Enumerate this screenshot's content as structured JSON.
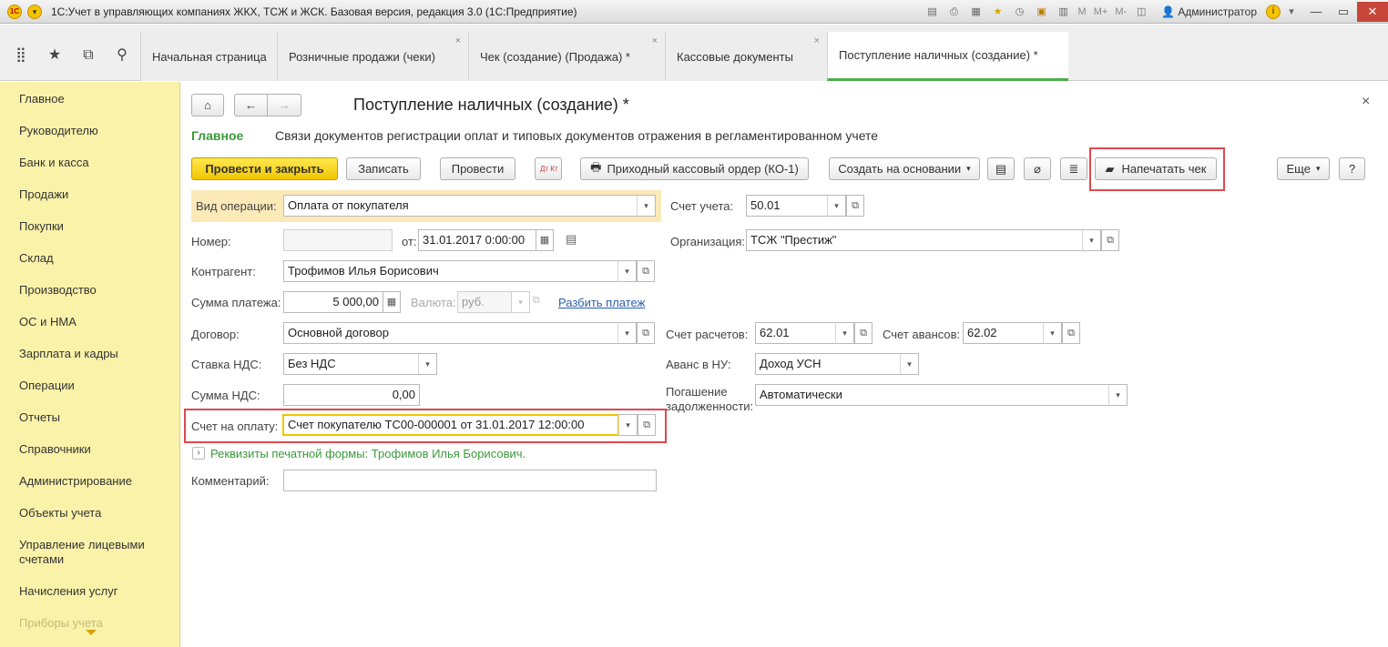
{
  "window": {
    "title": "1С:Учет в управляющих компаниях ЖКХ, ТСЖ и ЖСК. Базовая версия, редакция 3.0  (1С:Предприятие)",
    "user": "Администратор",
    "m_buttons": [
      "M",
      "M+",
      "M-"
    ]
  },
  "tabs": [
    {
      "label": "Начальная страница",
      "closable": false
    },
    {
      "label": "Розничные продажи (чеки)",
      "closable": true
    },
    {
      "label": "Чек (создание) (Продажа) *",
      "closable": true
    },
    {
      "label": "Кассовые документы",
      "closable": true
    },
    {
      "label": "Поступление наличных (создание) *",
      "closable": false,
      "active": true
    }
  ],
  "sidebar": {
    "items": [
      "Главное",
      "Руководителю",
      "Банк и касса",
      "Продажи",
      "Покупки",
      "Склад",
      "Производство",
      "ОС и НМА",
      "Зарплата и кадры",
      "Операции",
      "Отчеты",
      "Справочники",
      "Администрирование",
      "Объекты учета",
      "Управление лицевыми",
      "счетами",
      "Начисления услуг",
      "Приборы учета"
    ]
  },
  "doc": {
    "title": "Поступление наличных (создание) *",
    "nav_main": "Главное",
    "nav_links": "Связи документов регистрации оплат и типовых документов отражения в регламентированном учете",
    "close": "×"
  },
  "toolbar": {
    "post_close": "Провести и закрыть",
    "save": "Записать",
    "post": "Провести",
    "dt_kt": "Дт Кт",
    "pko": "Приходный кассовый ордер (КО-1)",
    "create_based": "Создать на основании",
    "print_check": "Напечатать чек",
    "more": "Еще",
    "help": "?"
  },
  "form": {
    "op_type_label": "Вид операции:",
    "op_type_value": "Оплата от покупателя",
    "number_label": "Номер:",
    "number_value": "",
    "from_label": "от:",
    "date_value": "31.01.2017  0:00:00",
    "counterparty_label": "Контрагент:",
    "counterparty_value": "Трофимов Илья Борисович",
    "amount_label": "Сумма платежа:",
    "amount_value": "5 000,00",
    "currency_label": "Валюта:",
    "currency_value": "руб.",
    "split_payment": "Разбить платеж",
    "contract_label": "Договор:",
    "contract_value": "Основной договор",
    "vat_rate_label": "Ставка НДС:",
    "vat_rate_value": "Без НДС",
    "vat_sum_label": "Сумма НДС:",
    "vat_sum_value": "0,00",
    "invoice_label": "Счет на оплату:",
    "invoice_value": "Счет покупателю ТС00-000001 от 31.01.2017 12:00:00",
    "print_requisites": "Реквизиты печатной формы: Трофимов Илья Борисович.",
    "comment_label": "Комментарий:",
    "comment_value": "",
    "account_label": "Счет учета:",
    "account_value": "50.01",
    "org_label": "Организация:",
    "org_value": "ТСЖ \"Престиж\"",
    "settle_label": "Счет расчетов:",
    "settle_value": "62.01",
    "advance_acc_label": "Счет авансов:",
    "advance_acc_value": "62.02",
    "advance_nu_label": "Аванс в НУ:",
    "advance_nu_value": "Доход УСН",
    "repay_label_1": "Погашение",
    "repay_label_2": "задолженности:",
    "repay_value": "Автоматически"
  },
  "colors": {
    "sidebar_bg": "#fbf2a9",
    "primary_button": "#f2c600",
    "active_tab_accent": "#4bb04b",
    "highlight_box": "#e0484e",
    "section_green": "#3a9a3a"
  }
}
